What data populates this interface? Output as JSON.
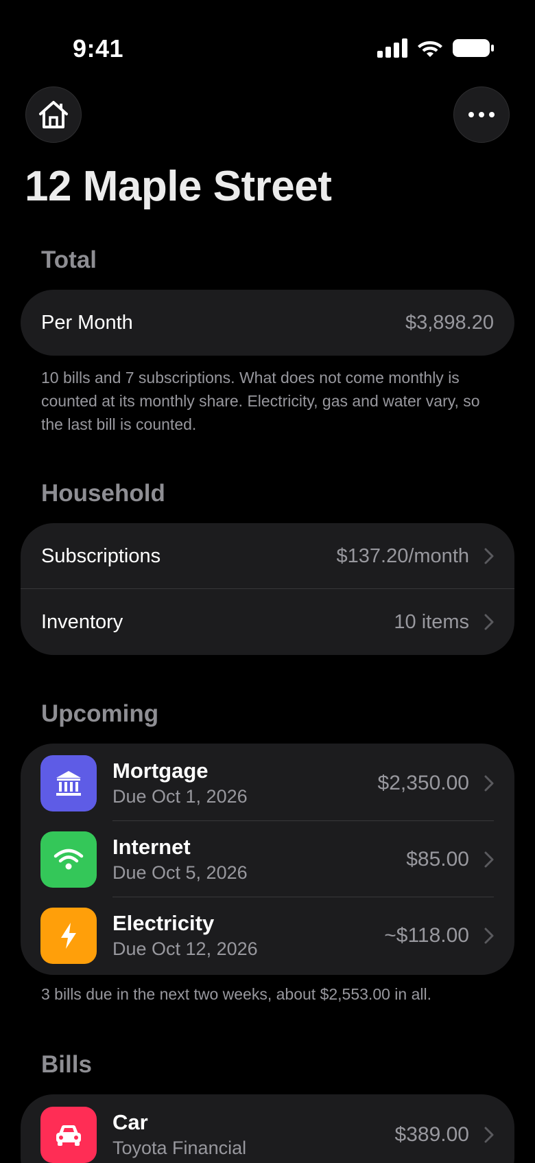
{
  "status": {
    "time": "9:41"
  },
  "header": {
    "title": "12 Maple Street"
  },
  "total": {
    "heading": "Total",
    "label": "Per Month",
    "value": "$3,898.20",
    "note": "10 bills and 7 subscriptions. What does not come monthly is counted at its monthly share. Electricity, gas and water vary, so the last bill is counted."
  },
  "household": {
    "heading": "Household",
    "items": [
      {
        "label": "Subscriptions",
        "value": "$137.20/month"
      },
      {
        "label": "Inventory",
        "value": "10 items"
      }
    ]
  },
  "upcoming": {
    "heading": "Upcoming",
    "items": [
      {
        "title": "Mortgage",
        "subtitle": "Due Oct 1, 2026",
        "amount": "$2,350.00",
        "icon": "bank-icon",
        "color": "#5e5ce6"
      },
      {
        "title": "Internet",
        "subtitle": "Due Oct 5, 2026",
        "amount": "$85.00",
        "icon": "wifi-icon",
        "color": "#34c759"
      },
      {
        "title": "Electricity",
        "subtitle": "Due Oct 12, 2026",
        "amount": "~$118.00",
        "icon": "bolt-icon",
        "color": "#ff9f0a"
      }
    ],
    "note": "3 bills due in the next two weeks, about $2,553.00 in all."
  },
  "bills": {
    "heading": "Bills",
    "items": [
      {
        "title": "Car",
        "subtitle": "Toyota Financial",
        "amount": "$389.00",
        "icon": "car-icon",
        "color": "#ff2d55"
      }
    ]
  }
}
